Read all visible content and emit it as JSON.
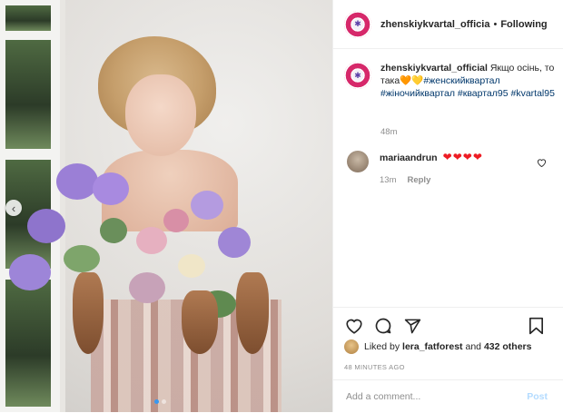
{
  "post": {
    "username": "zhenskiykvartal_officia",
    "separator": "•",
    "follow_status": "Following"
  },
  "caption": {
    "username": "zhenskiykvartal_official",
    "text": "Якщо осінь, то така",
    "emoji": "🧡💛",
    "hashtags": [
      "#женскийквартал",
      "#жіночийквартал",
      "#квартал95",
      "#kvartal95"
    ],
    "time": "48m"
  },
  "comment": {
    "username": "mariaandrun",
    "hearts": "❤❤❤❤",
    "time": "13m",
    "reply_label": "Reply"
  },
  "likes": {
    "prefix": "Liked by",
    "user": "lera_fatforest",
    "middle": "and",
    "others": "432 others"
  },
  "timestamp": "48 MINUTES AGO",
  "comment_input": {
    "placeholder": "Add a comment..."
  },
  "post_button": "Post",
  "colors": {
    "link": "#00376b",
    "muted": "#8e8e8e",
    "post_disabled": "#b3dbff",
    "carousel_active_dot": "#3897f0"
  },
  "icons": [
    "chevron-left-icon",
    "heart-icon",
    "comment-icon",
    "share-icon",
    "bookmark-icon",
    "small-heart-icon"
  ]
}
